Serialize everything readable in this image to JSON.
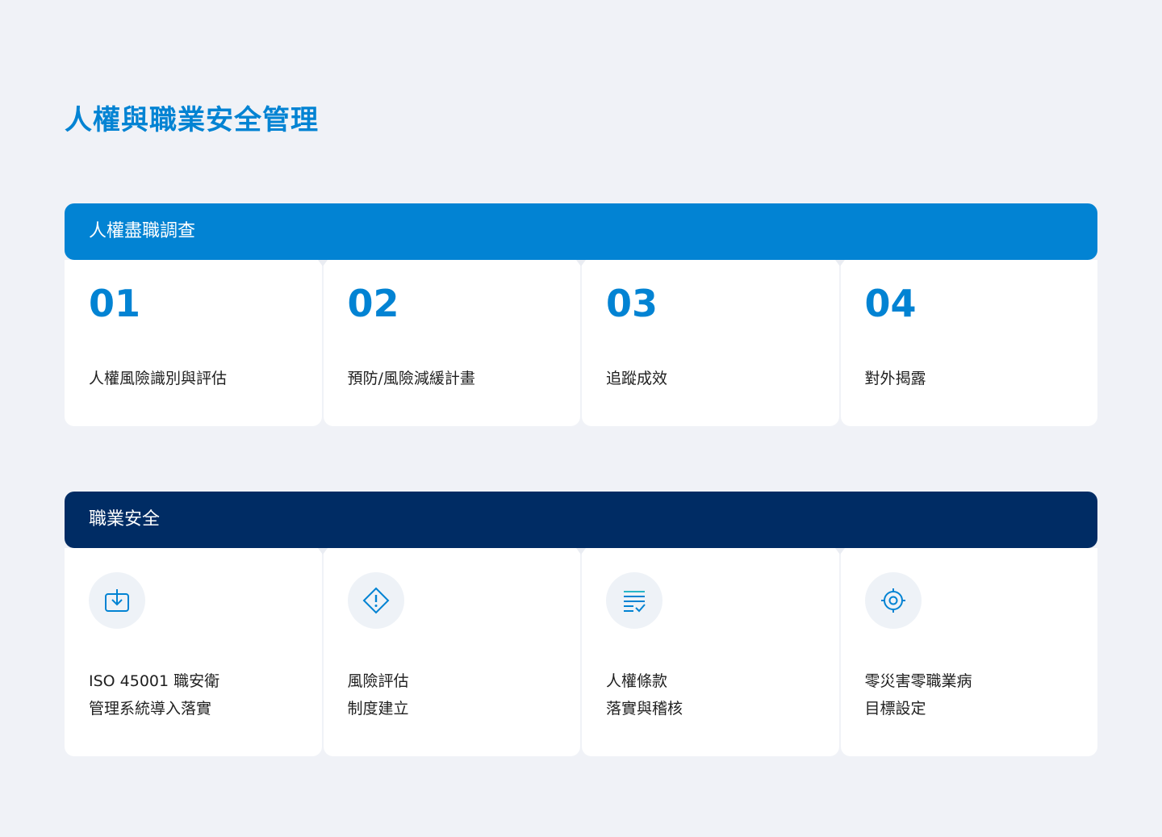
{
  "page": {
    "title": "人權與職業安全管理"
  },
  "due_diligence": {
    "header": "人權盡職調查",
    "steps": [
      {
        "number": "01",
        "label": "人權風險識別與評估"
      },
      {
        "number": "02",
        "label": "預防/風險減緩計畫"
      },
      {
        "number": "03",
        "label": "追蹤成效"
      },
      {
        "number": "04",
        "label": "對外揭露"
      }
    ]
  },
  "occupational_safety": {
    "header": "職業安全",
    "items": [
      {
        "icon": "download-tray-icon",
        "line1": "ISO 45001 職安衛",
        "line2": "管理系統導入落實"
      },
      {
        "icon": "warning-diamond-icon",
        "line1": "風險評估",
        "line2": "制度建立"
      },
      {
        "icon": "checklist-icon",
        "line1": "人權條款",
        "line2": "落實與稽核"
      },
      {
        "icon": "target-icon",
        "line1": "零災害零職業病",
        "line2": "目標設定"
      }
    ]
  },
  "colors": {
    "accent_blue": "#0283d3",
    "navy": "#002c64",
    "background": "#f0f2f7"
  }
}
